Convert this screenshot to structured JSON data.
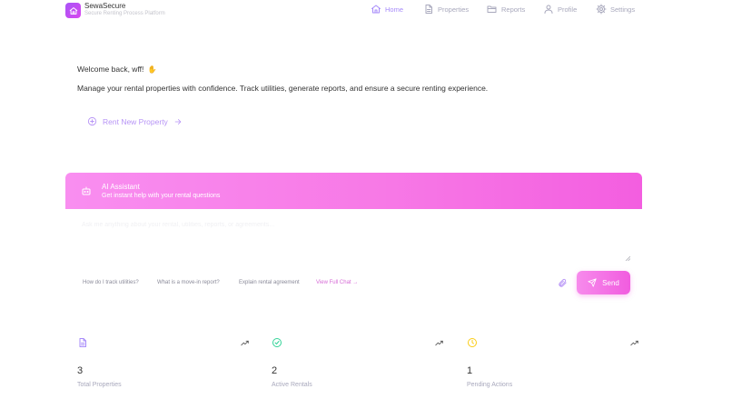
{
  "header": {
    "brand_name": "SewaSecure",
    "brand_tagline": "Secure Renting Process Platform",
    "nav": [
      {
        "label": "Home",
        "icon": "home-icon",
        "active": true
      },
      {
        "label": "Properties",
        "icon": "document-icon",
        "active": false
      },
      {
        "label": "Reports",
        "icon": "folder-icon",
        "active": false
      },
      {
        "label": "Profile",
        "icon": "user-icon",
        "active": false
      },
      {
        "label": "Settings",
        "icon": "gear-icon",
        "active": false
      }
    ]
  },
  "welcome": {
    "greeting": "Welcome back, wff!",
    "wave_icon": "waving-hand-icon",
    "message": "Manage your rental properties with confidence. Track utilities, generate reports, and ensure a secure renting experience.",
    "rent_link_label": "Rent New Property"
  },
  "ai_assistant": {
    "title": "AI Assistant",
    "subtitle": "Get instant help with your rental questions",
    "input_placeholder": "Ask me anything about your rental, utilities, reports, or agreements...",
    "suggestions": [
      "How do I track utilities?",
      "What is a move-in report?",
      "Explain rental agreement"
    ],
    "view_full_chat": "View Full Chat →",
    "send_label": "Send"
  },
  "stats": [
    {
      "value": "3",
      "label": "Total Properties",
      "icon": "document-icon",
      "color": "#a78bfa"
    },
    {
      "value": "2",
      "label": "Active Rentals",
      "icon": "check-circle-icon",
      "color": "#34d399"
    },
    {
      "value": "1",
      "label": "Pending Actions",
      "icon": "clock-icon",
      "color": "#facc15"
    }
  ],
  "colors": {
    "accent": "#a78bfa",
    "ai_gradient_start": "#f98ef0",
    "ai_gradient_end": "#f35ee0"
  }
}
